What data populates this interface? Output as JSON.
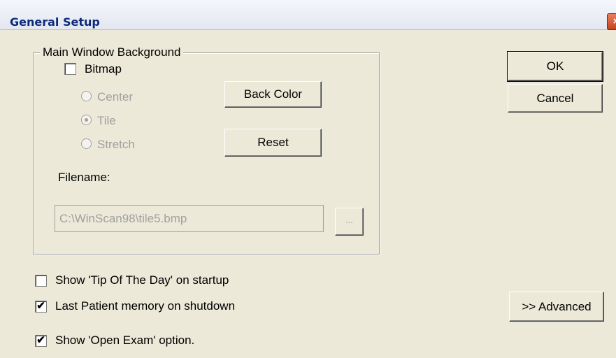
{
  "window": {
    "title": "General Setup",
    "close_glyph": "×"
  },
  "background_group": {
    "legend": "Main Window Background",
    "bitmap": {
      "label": "Bitmap",
      "checked": false
    },
    "radios": [
      {
        "label": "Center",
        "selected": false,
        "enabled": false
      },
      {
        "label": "Tile",
        "selected": true,
        "enabled": false
      },
      {
        "label": "Stretch",
        "selected": false,
        "enabled": false
      }
    ],
    "back_color_label": "Back Color",
    "reset_label": "Reset",
    "filename_label": "Filename:",
    "filename_value": "C:\\WinScan98\\tile5.bmp",
    "browse_label": "..."
  },
  "buttons": {
    "ok": "OK",
    "cancel": "Cancel",
    "advanced": ">> Advanced"
  },
  "options": [
    {
      "label": "Show 'Tip Of The Day' on startup",
      "checked": false
    },
    {
      "label": "Last Patient memory on shutdown",
      "checked": true
    },
    {
      "label": "Show 'Open Exam' option.",
      "checked": true
    }
  ],
  "glyphs": {
    "checkmark": "✔"
  }
}
